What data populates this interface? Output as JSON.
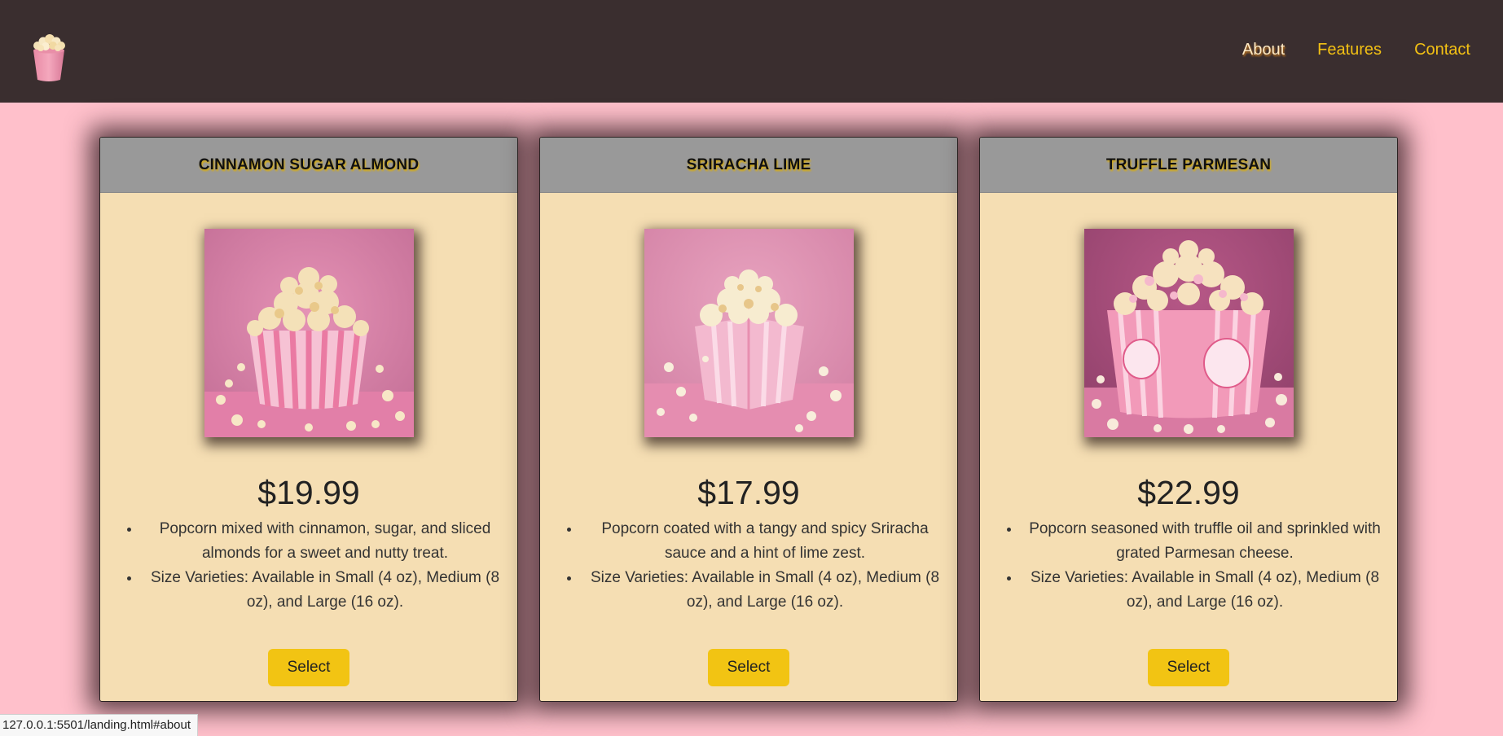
{
  "nav": {
    "logo_icon": "popcorn-bucket-icon",
    "links": [
      "About",
      "Features",
      "Contact"
    ],
    "active_link": "About"
  },
  "colors": {
    "nav_bg": "#3a2e2f",
    "page_bg": "#ffc0cb",
    "link": "#f2c014",
    "card_bg": "#f5deb3",
    "card_header": "#999999",
    "button": "#f2c413"
  },
  "cards": [
    {
      "title": "CINNAMON SUGAR ALMOND",
      "image": "popcorn-striped-cup-image",
      "price": "$19.99",
      "features": [
        "Popcorn mixed with cinnamon, sugar, and sliced almonds for a sweet and nutty treat.",
        "Size Varieties: Available in Small (4 oz), Medium (8 oz), and Large (16 oz)."
      ],
      "button": "Select"
    },
    {
      "title": "SRIRACHA LIME",
      "image": "popcorn-paper-box-image",
      "price": "$17.99",
      "features": [
        "Popcorn coated with a tangy and spicy Sriracha sauce and a hint of lime zest.",
        "Size Varieties: Available in Small (4 oz), Medium (8 oz), and Large (16 oz)."
      ],
      "button": "Select"
    },
    {
      "title": "TRUFFLE PARMESAN",
      "image": "popcorn-branded-box-image",
      "price": "$22.99",
      "features": [
        "Popcorn seasoned with truffle oil and sprinkled with grated Parmesan cheese.",
        "Size Varieties: Available in Small (4 oz), Medium (8 oz), and Large (16 oz)."
      ],
      "button": "Select"
    }
  ],
  "status_bar": {
    "url": "127.0.0.1:5501/landing.html#about"
  }
}
